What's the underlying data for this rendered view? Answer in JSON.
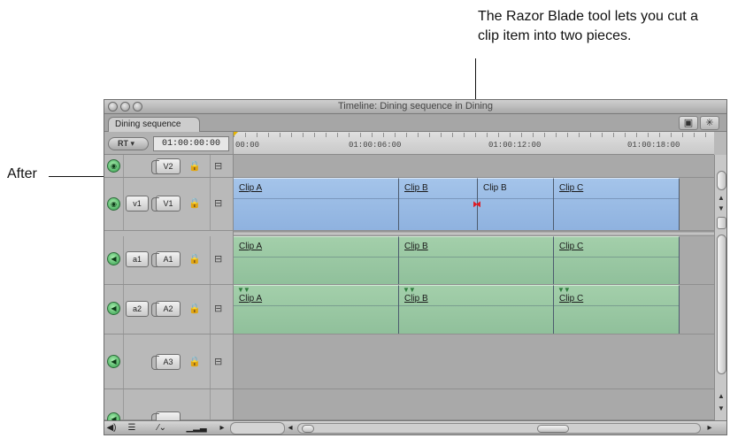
{
  "annotations": {
    "callout": "The Razor Blade tool lets you cut a clip item into two pieces.",
    "after": "After"
  },
  "window": {
    "title": "Timeline: Dining sequence in Dining",
    "tab": "Dining sequence",
    "rt_button": "RT ▾",
    "timecode": "01:00:00:00"
  },
  "ruler": {
    "labels": [
      "00:00",
      "01:00:06:00",
      "01:00:12:00",
      "01:00:18:00"
    ]
  },
  "tracks": {
    "v2": {
      "dest": "V2"
    },
    "v1": {
      "patch": "v1",
      "dest": "V1"
    },
    "a1": {
      "patch": "a1",
      "dest": "A1"
    },
    "a2": {
      "patch": "a2",
      "dest": "A2"
    },
    "a3": {
      "dest": "A3"
    }
  },
  "clips": {
    "v1": [
      "Clip A",
      "Clip B",
      "Clip B",
      "Clip C"
    ],
    "a1": [
      "Clip A",
      "Clip B",
      "Clip C"
    ],
    "a2": [
      "Clip A",
      "Clip B",
      "Clip C"
    ]
  },
  "colors": {
    "video_clip": "#9bbde6",
    "audio_clip": "#9cc9a4",
    "razor_marker": "#e01b24"
  }
}
